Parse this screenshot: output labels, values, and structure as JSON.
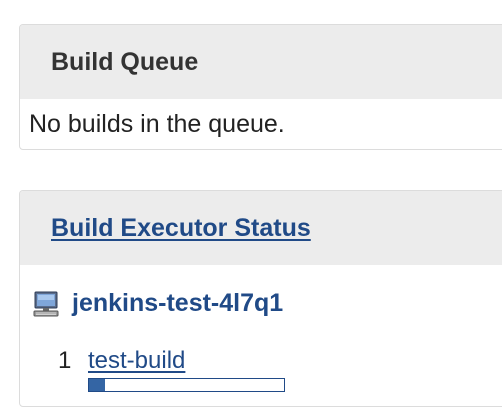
{
  "build_queue": {
    "title": "Build Queue",
    "empty_message": "No builds in the queue."
  },
  "executor_status": {
    "title": "Build Executor Status",
    "node": {
      "name": "jenkins-test-4l7q1",
      "icon": "computer-icon"
    },
    "executors": [
      {
        "number": "1",
        "build_name": "test-build",
        "progress_fraction": 0.08
      }
    ]
  },
  "colors": {
    "link": "#204a87",
    "progress_fill": "#3465a4",
    "header_bg": "#ececec"
  }
}
